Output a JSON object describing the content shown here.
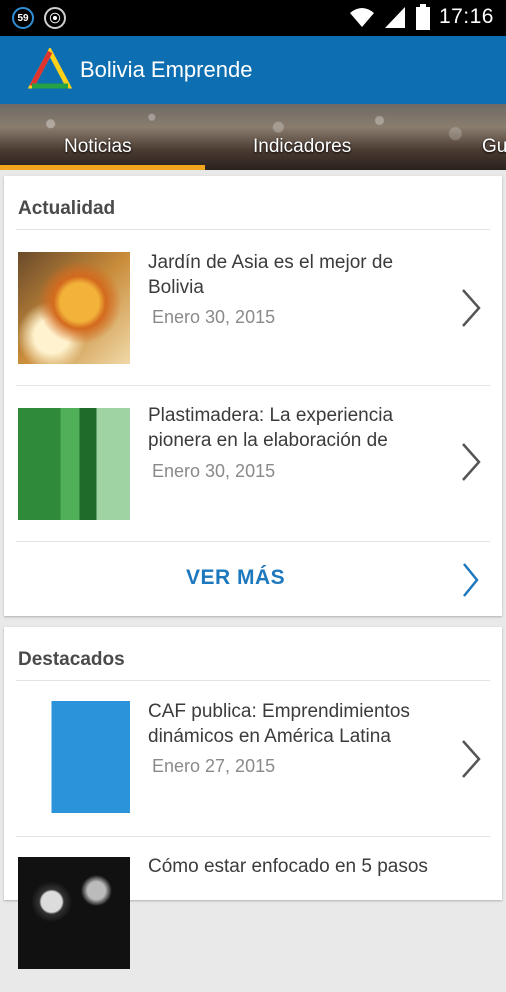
{
  "status_bar": {
    "badge_1": "59",
    "badge_2": "⦿",
    "time": "17:16"
  },
  "app": {
    "title": "Bolivia Emprende"
  },
  "tabs": [
    {
      "label": "Noticias"
    },
    {
      "label": "Indicadores"
    },
    {
      "label": "Gu"
    }
  ],
  "sections": [
    {
      "title": "Actualidad",
      "items": [
        {
          "title": "Jardín de Asia es el mejor de Bolivia",
          "date": "Enero 30, 2015"
        },
        {
          "title": "Plastimadera: La experiencia pionera en la elaboración de",
          "date": "Enero 30, 2015"
        }
      ],
      "more_label": "VER MÁS"
    },
    {
      "title": "Destacados",
      "items": [
        {
          "title": "CAF publica: Emprendimientos dinámicos en América Latina",
          "date": "Enero 27, 2015"
        },
        {
          "title": "Cómo estar enfocado en 5 pasos",
          "date": ""
        }
      ]
    }
  ],
  "colors": {
    "appbar": "#0d6fb1",
    "tab_indicator": "#f2a51d",
    "accent_link": "#1e78bd"
  },
  "icons": [
    "wifi-icon",
    "signal-icon",
    "battery-icon",
    "chevron-right-icon",
    "app-logo-icon"
  ]
}
